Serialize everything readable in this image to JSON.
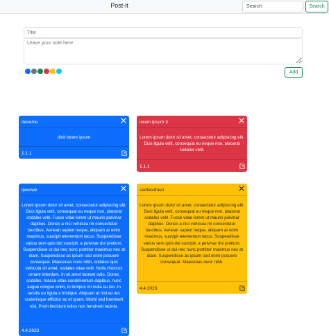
{
  "navbar": {
    "brand": "Post-it",
    "search_placeholder": "Search",
    "search_label": "Search"
  },
  "form": {
    "title_placeholder": "Title",
    "body_placeholder": "Leave your note here",
    "add_label": "Add",
    "colors": [
      "#0d6efd",
      "#6c757d",
      "#198754",
      "#dc3545",
      "#ffc107",
      "#0dcaf0",
      "#ffffff"
    ]
  },
  "notes": [
    {
      "title": "deneme",
      "body": "dlolr lorem ipsum",
      "date": "1.1.1",
      "color": "#0d6efd"
    },
    {
      "title": "lorem ipsum 3",
      "body": "Lorem ipsum dolor sit amet, consectetur adipiscing elit. Duis ligula velit, consequat eu neque non, placerat sodales velit.",
      "date": "1.1.1",
      "color": "#dc3545"
    },
    {
      "title": "qwerwe",
      "body": "Lorem ipsum dolor sit amet, consectetur adipiscing elit. Duis ligula velit, consequat eu neque non, placerat sodales velit. Fusce vitae lorem ut mauris pulvinar dapibus. Donec a nisi vehicula mi consectetur faucibus. Aenean sapien neque, aliquam at enim maximus, suscipit elementum lacus. Suspendisse varius sem quis dui suscipit, a pulvinar dui pretium. Suspendisse ut dui nec nunc porttitor maximus nec at diam. Suspendisse ac ipsum sed enim posuere consequat. Maecenas nunc nibh, sodales quis vehicula sit amet, sodales vitae velit. Nulla rhoncus ornare interdum. In sit amet laoreet odio. Donec sodales, massa vitae condimentum dapibus, nunc augue congue enim, in tempus mi nulla eu leo. In iaculis eu ligula a tristique. Aliquam at nisl eu leo scelerisque efficitur ac et quam. Morbi sed hendrerit nisi. Proin tincidunt tellus non hendrerit lacinia.",
      "date": "4.4.2023",
      "color": "#0d6efd"
    },
    {
      "title": "sadfasdfasd",
      "body": "Lorem ipsum dolor sit amet, consectetur adipiscing elit. Duis ligula velit, consequat eu neque non, placerat sodales velit. Fusce vitae lorem ut mauris pulvinar dapibus. Donec a nisi vehicula mi consectetur faucibus. Aenean sapien neque, aliquam at enim maximus, suscipit elementum lacus. Suspendisse varius sem quis dui suscipit, a pulvinar dui pretium. Suspendisse ut dui nec nunc porttitor maximus nec at diam. Suspendisse ac ipsum sed enim posuere consequat. Maecenas nunc nibh.",
      "date": "4.4.2023",
      "color": "#ffc107"
    }
  ]
}
